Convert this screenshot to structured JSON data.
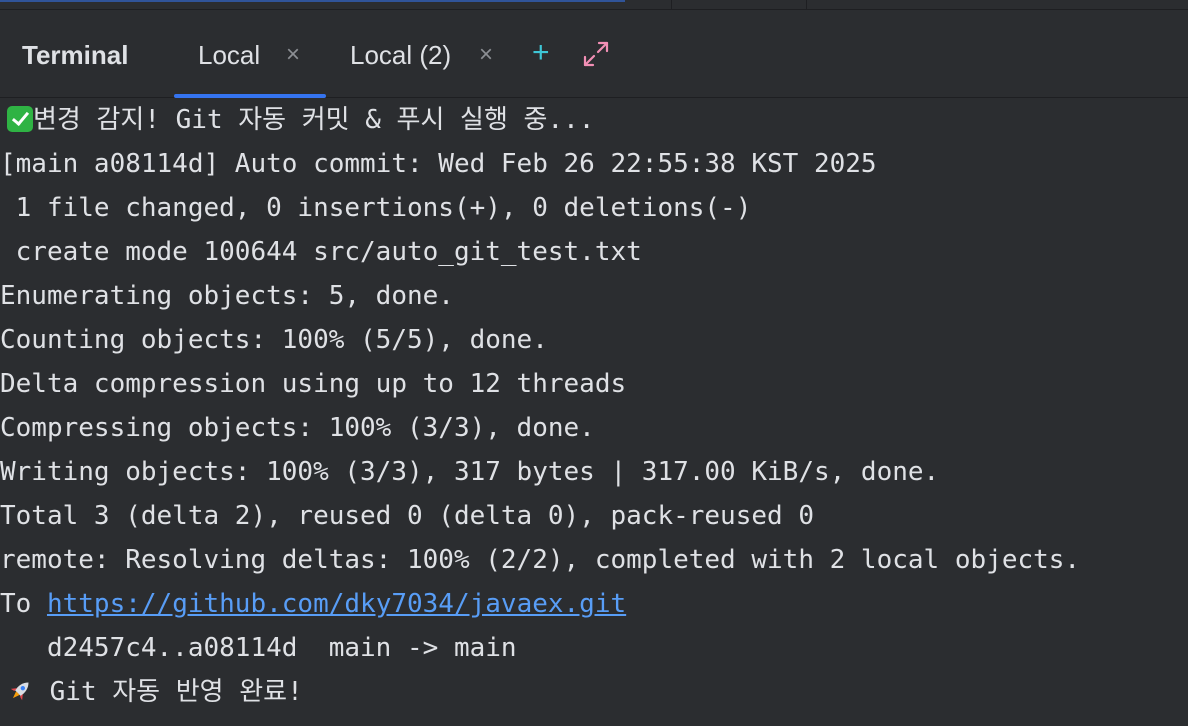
{
  "toolwindow": {
    "title": "Terminal",
    "tabs": [
      {
        "label": "Local",
        "close": "×"
      },
      {
        "label": "Local (2)",
        "close": "×"
      }
    ],
    "add_icon": "plus-icon",
    "maximize_icon": "maximize-icon"
  },
  "colors": {
    "background": "#2b2d30",
    "text": "#dfe1e5",
    "accent": "#3574f0",
    "link": "#589df6",
    "add_icon": "#3ec6d6",
    "maximize_icon": "#f28fb5"
  },
  "terminal": {
    "lines": [
      {
        "icon": "check-icon",
        "text": "변경 감지! Git 자동 커밋 & 푸시 실행 중..."
      },
      {
        "text": "[main a08114d] Auto commit: Wed Feb 26 22:55:38 KST 2025"
      },
      {
        "text": " 1 file changed, 0 insertions(+), 0 deletions(-)"
      },
      {
        "text": " create mode 100644 src/auto_git_test.txt"
      },
      {
        "text": "Enumerating objects: 5, done."
      },
      {
        "text": "Counting objects: 100% (5/5), done."
      },
      {
        "text": "Delta compression using up to 12 threads"
      },
      {
        "text": "Compressing objects: 100% (3/3), done."
      },
      {
        "text": "Writing objects: 100% (3/3), 317 bytes | 317.00 KiB/s, done."
      },
      {
        "text": "Total 3 (delta 2), reused 0 (delta 0), pack-reused 0"
      },
      {
        "text": "remote: Resolving deltas: 100% (2/2), completed with 2 local objects."
      },
      {
        "prefix": "To ",
        "link": "https://github.com/dky7034/javaex.git"
      },
      {
        "text": "   d2457c4..a08114d  main -> main"
      },
      {
        "icon": "rocket-icon",
        "text": " Git 자동 반영 완료!"
      }
    ]
  }
}
